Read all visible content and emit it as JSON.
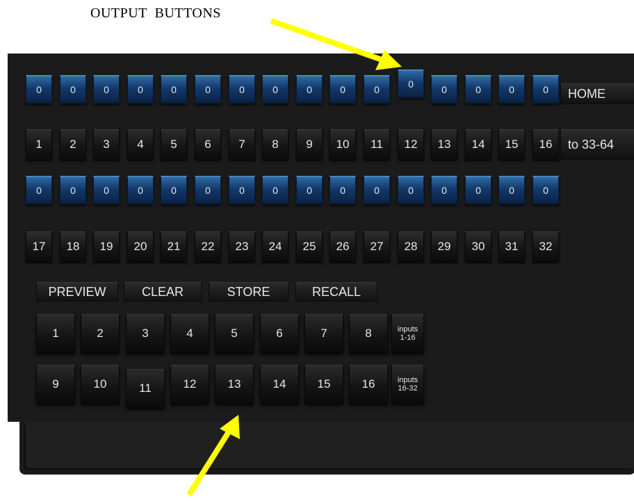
{
  "caption": "OUTPUT  BUTTONS",
  "outputs": {
    "row1_values": [
      "0",
      "0",
      "0",
      "0",
      "0",
      "0",
      "0",
      "0",
      "0",
      "0",
      "0",
      "0",
      "0",
      "0",
      "0",
      "0"
    ],
    "row1_numbers": [
      "1",
      "2",
      "3",
      "4",
      "5",
      "6",
      "7",
      "8",
      "9",
      "10",
      "11",
      "12",
      "13",
      "14",
      "15",
      "16"
    ],
    "row2_values": [
      "0",
      "0",
      "0",
      "0",
      "0",
      "0",
      "0",
      "0",
      "0",
      "0",
      "0",
      "0",
      "0",
      "0",
      "0",
      "0"
    ],
    "row2_numbers": [
      "17",
      "18",
      "19",
      "20",
      "21",
      "22",
      "23",
      "24",
      "25",
      "26",
      "27",
      "28",
      "29",
      "30",
      "31",
      "32"
    ]
  },
  "side": {
    "home": "HOME",
    "page": "to 33-64"
  },
  "controls": [
    "PREVIEW",
    "CLEAR",
    "STORE",
    "RECALL"
  ],
  "inputs": {
    "row1": [
      "1",
      "2",
      "3",
      "4",
      "5",
      "6",
      "7",
      "8"
    ],
    "row1_bank": [
      "inputs",
      "1-16"
    ],
    "row2": [
      "9",
      "10",
      "11",
      "12",
      "13",
      "14",
      "15",
      "16"
    ],
    "row2_bank": [
      "inputs",
      "16-32"
    ]
  },
  "colors": {
    "arrow": "#ffff00",
    "value_button": "#1a4f8a",
    "panel": "#1b1b1c"
  }
}
